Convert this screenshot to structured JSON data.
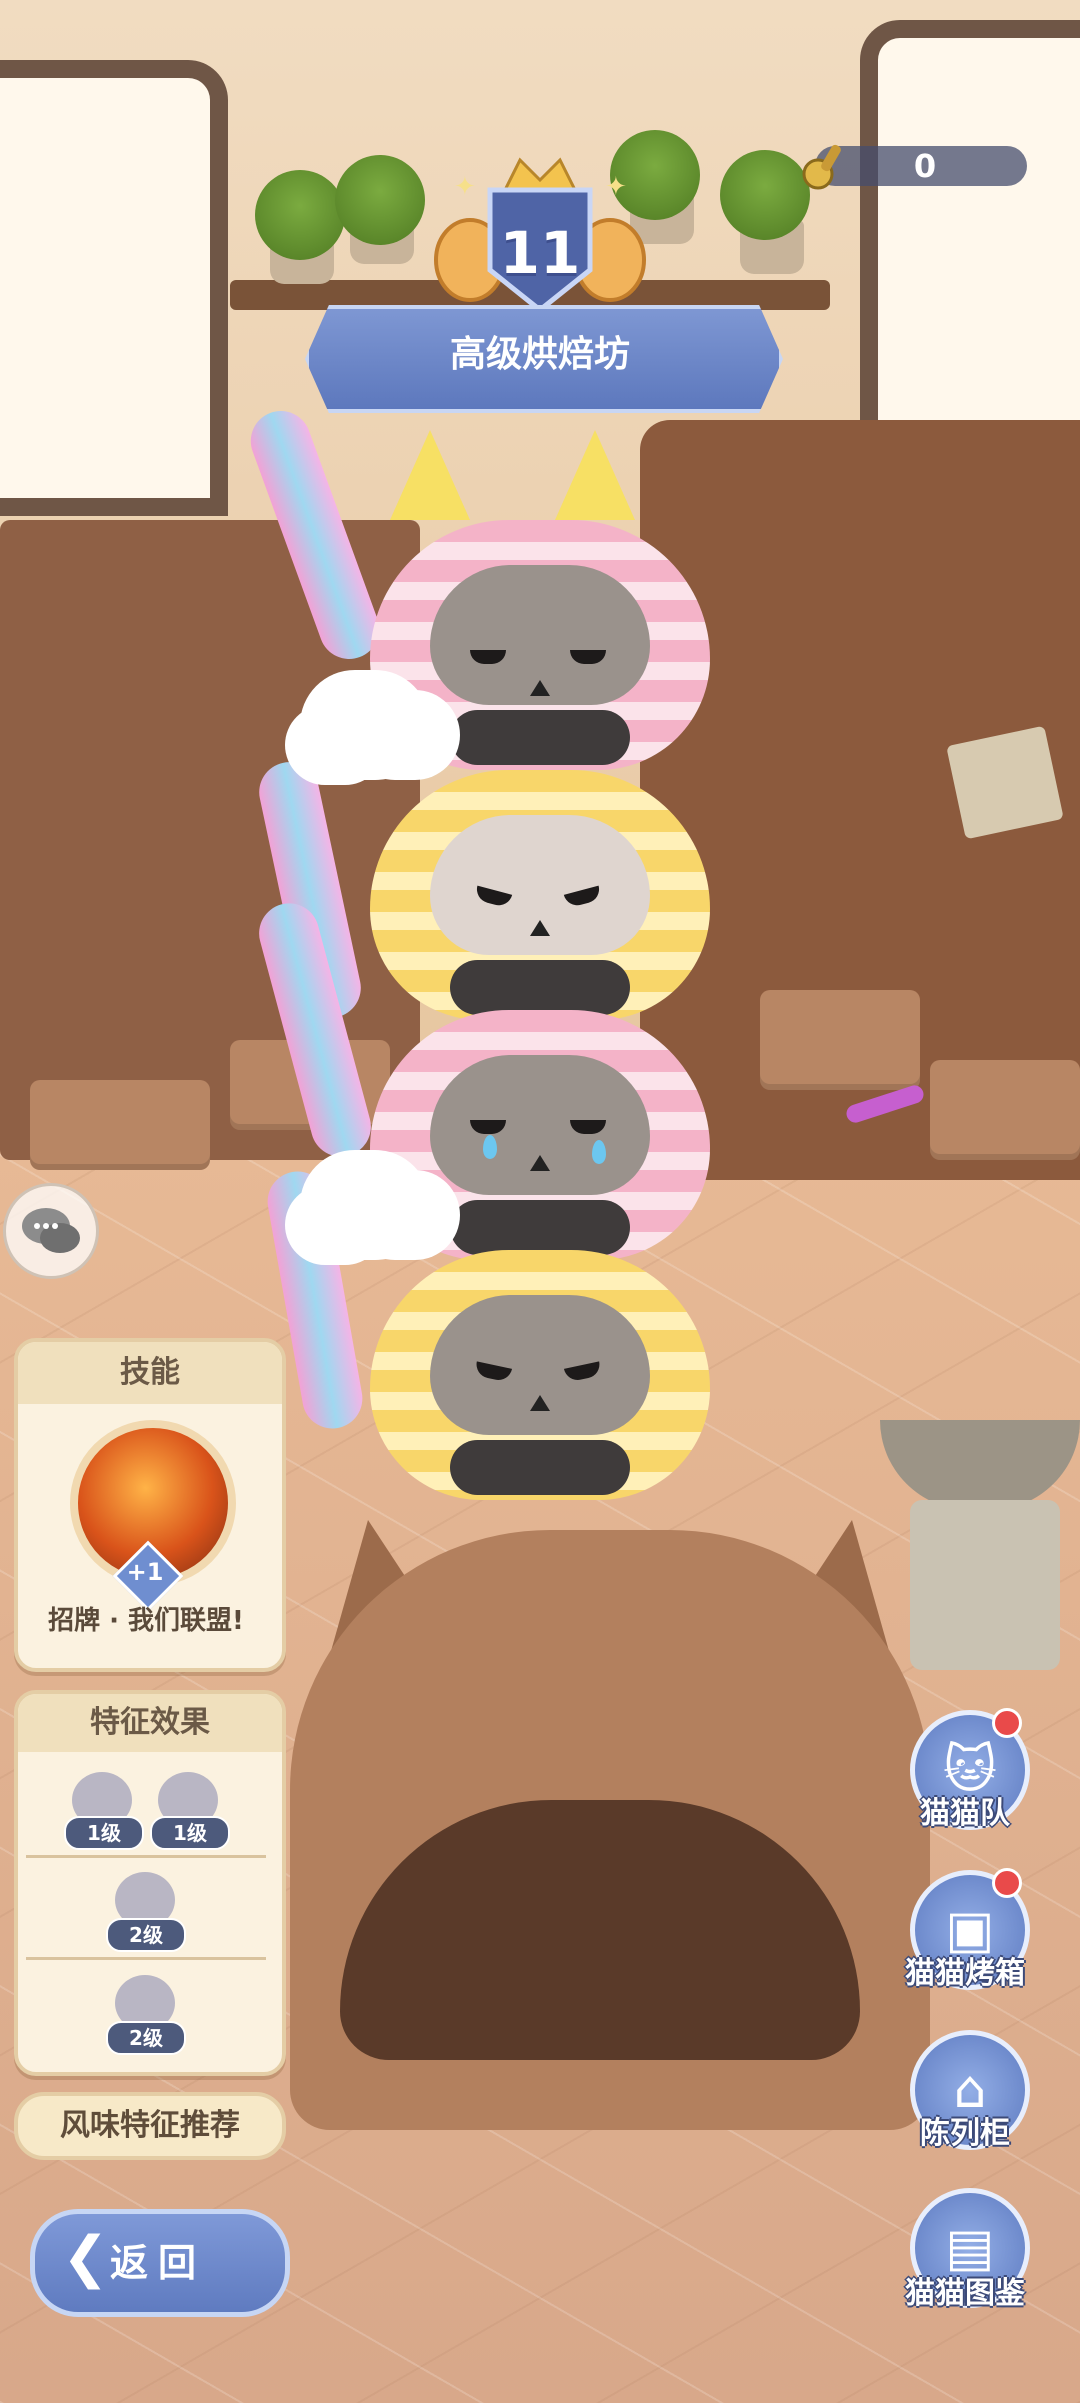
{
  "hud": {
    "currency_value": "0",
    "currency_icon": "golden-whisk-icon"
  },
  "level": {
    "number": "11",
    "title": "高级烘焙坊"
  },
  "skill_panel": {
    "header": "技能",
    "skill_name": "招牌 · 我们联盟!",
    "badge": "+1"
  },
  "trait_panel": {
    "header": "特征效果",
    "rows": [
      {
        "items": [
          {
            "icon": "trait-flower-icon",
            "level": "1级"
          },
          {
            "icon": "trait-brain-icon",
            "level": "1级"
          }
        ]
      },
      {
        "items": [
          {
            "icon": "trait-fist-icon",
            "level": "2级"
          }
        ]
      },
      {
        "items": [
          {
            "icon": "trait-drumstick-icon",
            "level": "2级"
          }
        ]
      }
    ]
  },
  "recommend_button": "风味特征推荐",
  "back_button": "返回",
  "side_menu": [
    {
      "label": "猫猫队",
      "icon": "cat-team-icon",
      "notify": true
    },
    {
      "label": "猫猫烤箱",
      "icon": "oven-icon",
      "notify": true
    },
    {
      "label": "陈列柜",
      "icon": "cabinet-icon",
      "notify": false
    },
    {
      "label": "猫猫图鉴",
      "icon": "book-icon",
      "notify": false
    }
  ],
  "colors": {
    "accent_blue": "#5d78bd",
    "panel_bg": "#fbf2e0",
    "notify_red": "#e94a4a"
  }
}
